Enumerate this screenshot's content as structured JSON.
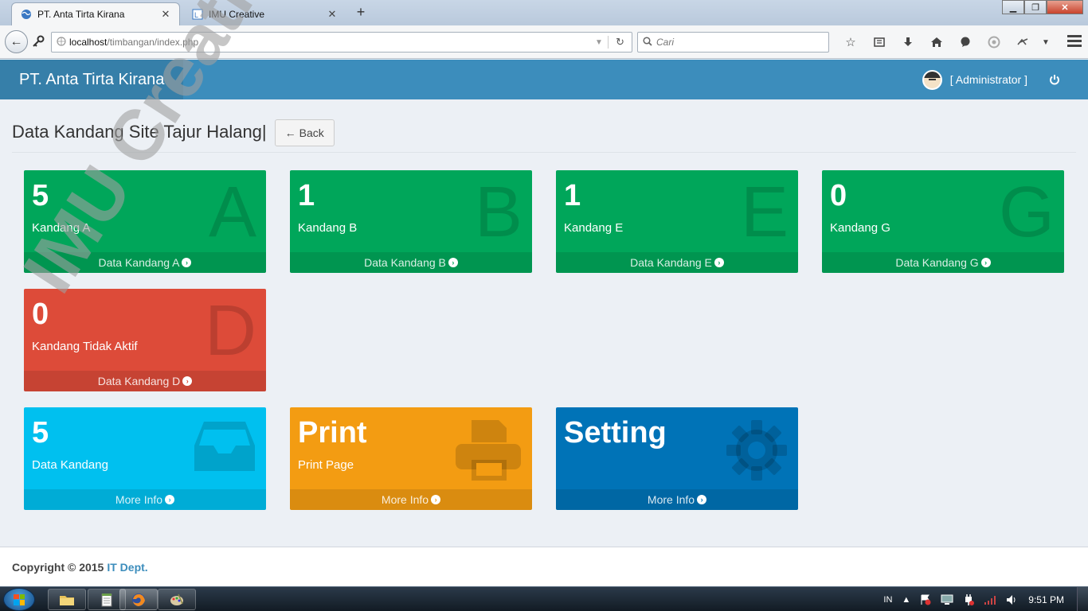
{
  "browser": {
    "tabs": [
      {
        "title": "PT. Anta Tirta Kirana",
        "active": true,
        "icon": "globe-icon"
      },
      {
        "title": "IMU Creative",
        "active": false,
        "icon": "page-icon"
      }
    ],
    "new_tab": "+",
    "url_host": "localhost",
    "url_path": "/timbangan/index.php",
    "search_placeholder": "Cari",
    "window_buttons": {
      "minimize": "▁",
      "maximize": "❐",
      "close": "✕"
    }
  },
  "header": {
    "brand": "PT. Anta Tirta Kirana",
    "user": "[ Administrator ]",
    "colors": {
      "header": "#3c8dbc",
      "brand": "#367fa9"
    }
  },
  "content": {
    "title": "Data Kandang Site Tajur Halang|",
    "back_label": "Back"
  },
  "boxes": [
    {
      "value": "5",
      "title": "Kandang A",
      "letter": "A",
      "link": "Data Kandang A",
      "color": "green"
    },
    {
      "value": "1",
      "title": "Kandang B",
      "letter": "B",
      "link": "Data Kandang B",
      "color": "green"
    },
    {
      "value": "1",
      "title": "Kandang E",
      "letter": "E",
      "link": "Data Kandang E",
      "color": "green"
    },
    {
      "value": "0",
      "title": "Kandang G",
      "letter": "G",
      "link": "Data Kandang G",
      "color": "green"
    },
    {
      "value": "0",
      "title": "Kandang Tidak Aktif",
      "letter": "D",
      "link": "Data Kandang D",
      "color": "red"
    },
    {
      "value": "5",
      "title": "Data Kandang",
      "icon": "inbox-icon",
      "link": "More Info",
      "color": "aqua"
    },
    {
      "value": "Print",
      "title": "Print Page",
      "icon": "printer-icon",
      "link": "More Info",
      "color": "yellow"
    },
    {
      "value": "Setting",
      "title": "",
      "icon": "gear-icon",
      "link": "More Info",
      "color": "blue"
    }
  ],
  "footer": {
    "copyright": "Copyright © 2015",
    "dept": "IT Dept."
  },
  "watermark": "IMU Creative",
  "taskbar": {
    "language": "IN",
    "time": "9:51 PM"
  }
}
